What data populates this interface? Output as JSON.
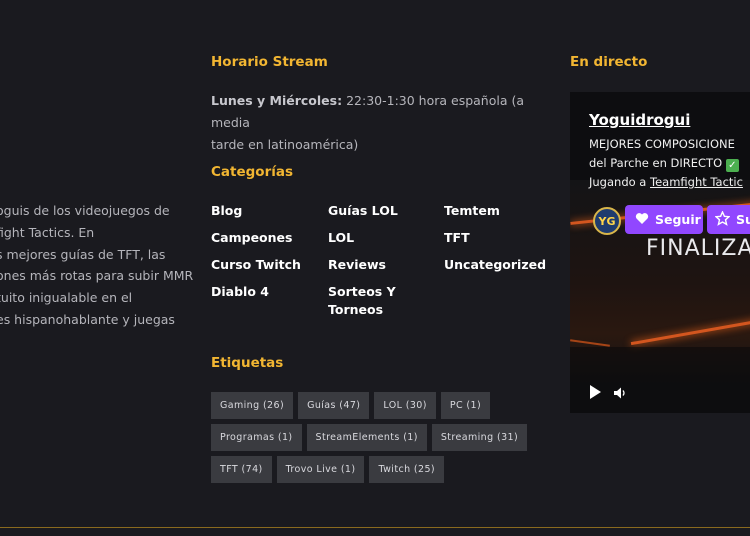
{
  "about": {
    "lines": [
      "oguis de los videojuegos de",
      "fight Tactics. En",
      "s mejores guías de TFT, las",
      "ones más rotas para subir MMR",
      "tuito inigualable en el",
      "es hispanohablante y juegas"
    ]
  },
  "horario": {
    "title": "Horario Stream",
    "days": "Lunes y Miércoles:",
    "line1_rest": " 22:30-1:30 hora española (a media",
    "line2": "tarde en latinoamérica)"
  },
  "categorias": {
    "title": "Categorías",
    "items": [
      "Blog",
      "Guías LOL",
      "Temtem",
      "Campeones",
      "LOL",
      "TFT",
      "Curso Twitch",
      "Reviews",
      "Uncategorized",
      "Diablo 4",
      "Sorteos Y",
      "Torneos"
    ]
  },
  "etiquetas": {
    "title": "Etiquetas",
    "tags": [
      "Gaming (26)",
      "Guías (47)",
      "LOL (30)",
      "PC (1)",
      "Programas (1)",
      "StreamElements (1)",
      "Streaming (31)",
      "TFT (74)",
      "Trovo Live (1)",
      "Twitch (25)"
    ]
  },
  "directo": {
    "title": "En directo",
    "channel": "Yoguidrogui",
    "desc1": "MEJORES COMPOSICIONE",
    "desc2": "del Parche en DIRECTO ",
    "desc3_prefix": "Jugando a ",
    "desc3_link": "Teamfight Tactic",
    "check": "✓",
    "follow": "Seguir",
    "subscribe": "Su",
    "overlay": "FINALIZA",
    "avatar": "YG"
  },
  "colors": {
    "accent": "#f2b632",
    "twitch": "#9147ff",
    "background": "#1a1a1f",
    "tag_bg": "#3a3b40"
  }
}
